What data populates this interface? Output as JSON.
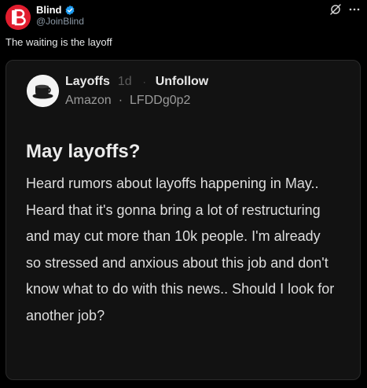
{
  "tweet": {
    "author_name": "Blind",
    "author_handle": "@JoinBlind",
    "text": "The waiting is the layoff"
  },
  "embed": {
    "channel": "Layoffs",
    "age": "1d",
    "separator": "·",
    "unfollow_label": "Unfollow",
    "company": "Amazon",
    "meta_separator": "·",
    "username": "LFDDg0p2",
    "title": "May layoffs?",
    "body": "Heard rumors about layoffs happening in May.. Heard that it's gonna bring a lot of restructuring and may cut more than 10k people. I'm already so stressed and anxious about this job and don't know what to do with this news.. Should I look for another job?"
  },
  "icons": {
    "author_avatar": "blind-logo-icon",
    "verified": "verified-badge-icon",
    "grok": "grok-icon",
    "more": "more-dots-icon",
    "poster_avatar": "coffee-cup-icon"
  },
  "colors": {
    "background": "#000000",
    "brand_red": "#e11d2e",
    "verified_blue": "#1d9bf0",
    "card_background": "#121212"
  }
}
